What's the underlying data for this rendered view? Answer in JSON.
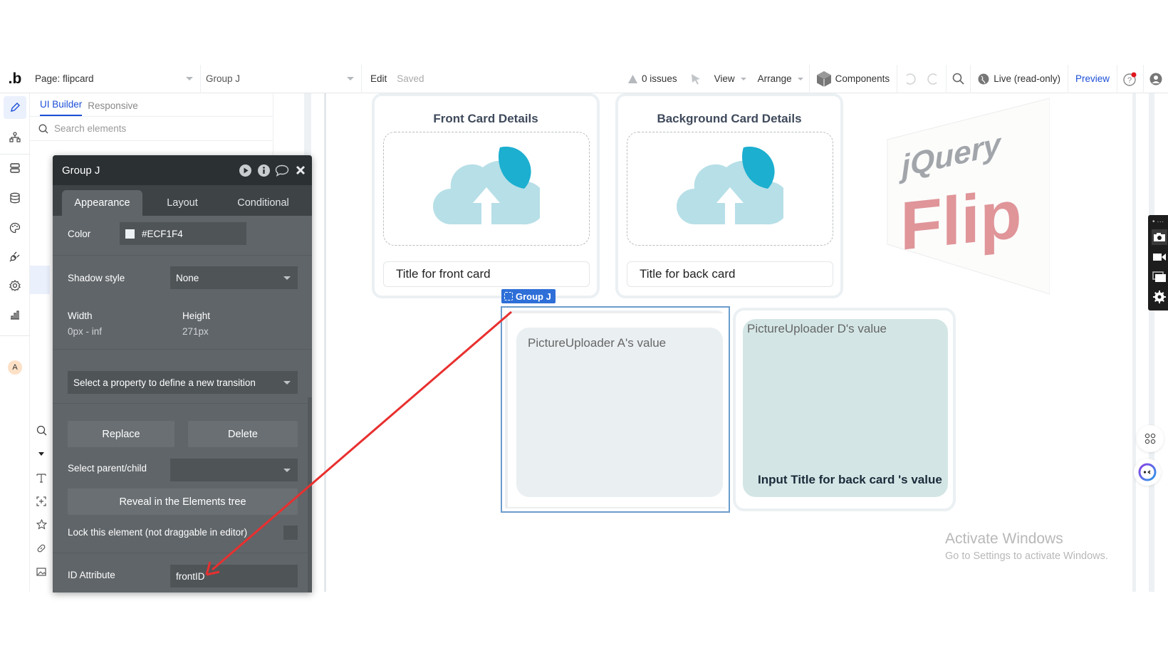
{
  "topbar": {
    "logo": ".b",
    "page_selector": "Page: flipcard",
    "element_selector": "Group J",
    "edit_label": "Edit",
    "saved_label": "Saved",
    "issues_label": "0 issues",
    "view_label": "View",
    "arrange_label": "Arrange",
    "components_label": "Components",
    "live_label": "Live (read-only)",
    "preview_label": "Preview"
  },
  "iconbar": {
    "items": [
      "design",
      "workflow",
      "data",
      "database",
      "styles",
      "plugins",
      "settings",
      "logs"
    ],
    "avatar_initial": "A"
  },
  "elements_panel": {
    "tabs": [
      {
        "label": "UI Builder",
        "active": true
      },
      {
        "label": "Responsive",
        "active": false
      }
    ],
    "search_placeholder": "Search elements"
  },
  "editor": {
    "title": "Group J",
    "tabs": [
      {
        "label": "Appearance",
        "active": true
      },
      {
        "label": "Layout",
        "active": false
      },
      {
        "label": "Conditional",
        "active": false
      }
    ],
    "color_label": "Color",
    "color_value": "#ECF1F4",
    "shadow_label": "Shadow style",
    "shadow_value": "None",
    "width_label": "Width",
    "width_value": "0px - inf",
    "height_label": "Height",
    "height_value": "271px",
    "transition_placeholder": "Select a property to define a new transition",
    "replace_label": "Replace",
    "delete_label": "Delete",
    "parent_child_label": "Select parent/child",
    "parent_child_value": "",
    "reveal_label": "Reveal in the Elements tree",
    "lock_label": "Lock this element (not draggable in editor)",
    "lock_checked": false,
    "id_attribute_label": "ID Attribute",
    "id_attribute_value": "frontID"
  },
  "canvas": {
    "front_card": {
      "title": "Front Card Details",
      "input_placeholder": "Title for front card"
    },
    "back_card": {
      "title": "Background Card Details",
      "input_placeholder": "Title for back card"
    },
    "group_tag": "Group J",
    "group_j_text": "PictureUploader A's value",
    "group_d_text": "PictureUploader D's value",
    "group_d_title": "Input Title for back card 's value",
    "logo": {
      "line1": "jQuery",
      "line2": "Flip"
    }
  },
  "watermark": {
    "line1": "Activate Windows",
    "line2": "Go to Settings to activate Windows."
  },
  "colors": {
    "accent": "#1b4fd6",
    "group_tag": "#2e6fd8",
    "arrow": "#e8302f",
    "editor_bg": "#606569",
    "editor_header": "#2b3032",
    "upload_light": "#b7dfe7",
    "upload_dark": "#1cafd0",
    "flip_red": "#e09599"
  }
}
